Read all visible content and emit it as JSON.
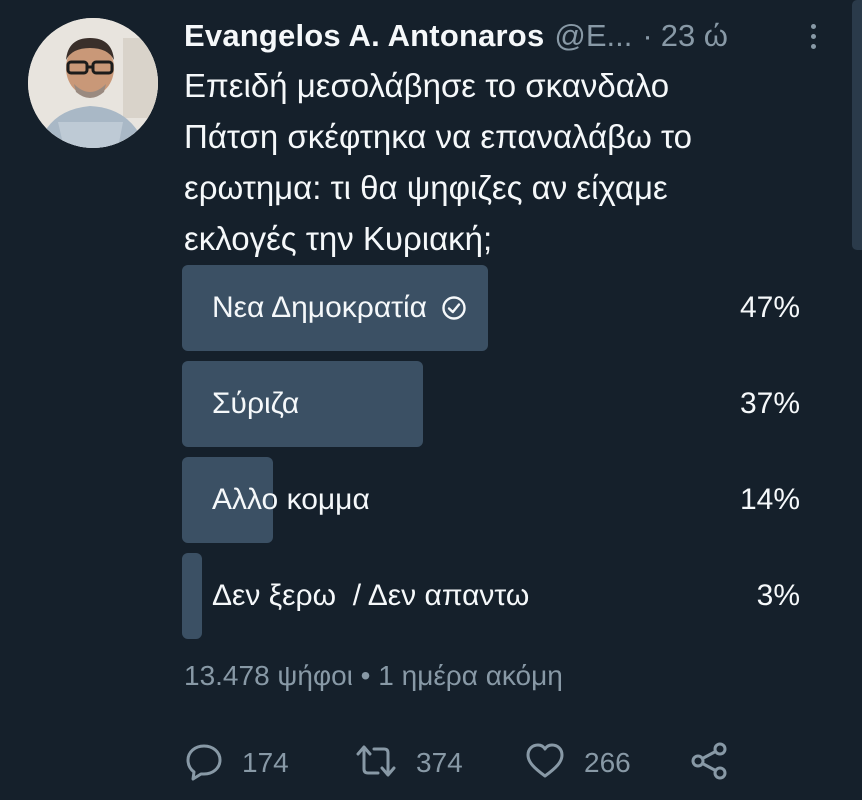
{
  "tweet": {
    "author_name": "Evangelos A. Antonaros",
    "handle": "@E...",
    "separator": "·",
    "time": "23 ώ",
    "text": "Επειδή μεσολάβησε το σκανδαλο\nΠάτση σκέφτηκα να επαναλάβω το\nερωτημα: τι θα ψηφιζες αν είχαμε\nεκλογές την Κυριακή;"
  },
  "poll": {
    "options": [
      {
        "label": "Νεα Δημοκρατία",
        "percent_text": "47%",
        "percent": 47,
        "selected": true
      },
      {
        "label": "Σύριζα",
        "percent_text": "37%",
        "percent": 37,
        "selected": false
      },
      {
        "label": "Αλλο κομμα",
        "percent_text": "14%",
        "percent": 14,
        "selected": false
      },
      {
        "label": "Δεν ξερω  / Δεν απαντω",
        "percent_text": "3%",
        "percent": 3,
        "selected": false
      }
    ],
    "meta": "13.478 ψήφοι • 1 ημέρα ακόμη"
  },
  "actions": {
    "replies": "174",
    "retweets": "374",
    "likes": "266"
  },
  "icons": {
    "more": "more-vertical-icon",
    "selected": "check-circle-icon",
    "reply": "reply-icon",
    "retweet": "retweet-icon",
    "like": "heart-icon",
    "share": "share-icon"
  },
  "colors": {
    "background": "#15202b",
    "poll_bar": "#3b5064",
    "secondary_text": "#8899a6",
    "primary_text": "#f5f8fa"
  }
}
